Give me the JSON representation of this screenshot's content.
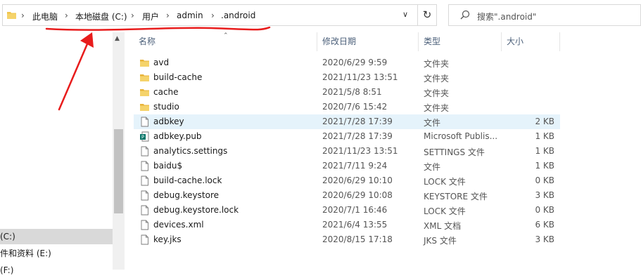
{
  "breadcrumb": {
    "items": [
      "此电脑",
      "本地磁盘 (C:)",
      "用户",
      "admin",
      ".android"
    ],
    "separator": "›"
  },
  "search": {
    "placeholder": "搜索\".android\""
  },
  "columns": {
    "name": "名称",
    "date": "修改日期",
    "type": "类型",
    "size": "大小"
  },
  "nav": {
    "items": [
      {
        "label": "(C:)",
        "selected": true
      },
      {
        "label": "件和资料 (E:)",
        "selected": false
      },
      {
        "label": "(F:)",
        "selected": false
      }
    ]
  },
  "files": [
    {
      "name": "avd",
      "date": "2020/6/29 9:59",
      "type": "文件夹",
      "size": "",
      "icon": "folder-icon"
    },
    {
      "name": "build-cache",
      "date": "2021/11/23 13:51",
      "type": "文件夹",
      "size": "",
      "icon": "folder-icon"
    },
    {
      "name": "cache",
      "date": "2021/5/8 8:51",
      "type": "文件夹",
      "size": "",
      "icon": "folder-icon"
    },
    {
      "name": "studio",
      "date": "2020/7/6 15:42",
      "type": "文件夹",
      "size": "",
      "icon": "folder-icon"
    },
    {
      "name": "adbkey",
      "date": "2021/7/28 17:39",
      "type": "文件",
      "size": "2 KB",
      "icon": "file-icon"
    },
    {
      "name": "adbkey.pub",
      "date": "2021/7/28 17:39",
      "type": "Microsoft Publis...",
      "size": "1 KB",
      "icon": "publisher-icon"
    },
    {
      "name": "analytics.settings",
      "date": "2021/11/23 13:51",
      "type": "SETTINGS 文件",
      "size": "1 KB",
      "icon": "file-icon"
    },
    {
      "name": "baidu$",
      "date": "2021/7/11 9:24",
      "type": "文件",
      "size": "1 KB",
      "icon": "file-icon"
    },
    {
      "name": "build-cache.lock",
      "date": "2020/6/29 10:10",
      "type": "LOCK 文件",
      "size": "0 KB",
      "icon": "file-icon"
    },
    {
      "name": "debug.keystore",
      "date": "2020/6/29 10:08",
      "type": "KEYSTORE 文件",
      "size": "3 KB",
      "icon": "file-icon"
    },
    {
      "name": "debug.keystore.lock",
      "date": "2020/7/1 16:46",
      "type": "LOCK 文件",
      "size": "0 KB",
      "icon": "file-icon"
    },
    {
      "name": "devices.xml",
      "date": "2021/6/4 13:55",
      "type": "XML 文档",
      "size": "6 KB",
      "icon": "file-icon"
    },
    {
      "name": "key.jks",
      "date": "2020/8/15 17:18",
      "type": "JKS 文件",
      "size": "3 KB",
      "icon": "file-icon"
    }
  ],
  "colors": {
    "annotation": "#e81c1c",
    "folder": "#f0c44b",
    "hover": "#e5f3fb"
  }
}
